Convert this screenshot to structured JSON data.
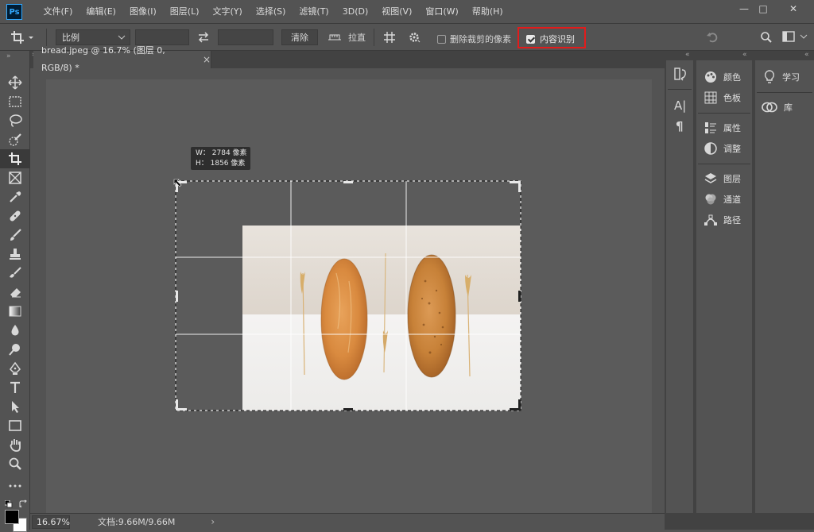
{
  "app": {
    "logo": "Ps"
  },
  "menu": [
    "文件(F)",
    "编辑(E)",
    "图像(I)",
    "图层(L)",
    "文字(Y)",
    "选择(S)",
    "滤镜(T)",
    "3D(D)",
    "视图(V)",
    "窗口(W)",
    "帮助(H)"
  ],
  "window_controls": {
    "minimize": "—",
    "maximize": "□",
    "close": "✕"
  },
  "options": {
    "ratio_select": "比例",
    "clear_label": "清除",
    "straighten_label": "拉直",
    "delete_cropped_label": "删除裁剪的像素",
    "delete_cropped_checked": false,
    "content_aware_label": "内容识别",
    "content_aware_checked": true,
    "highlight_color": "#e21b1b"
  },
  "document": {
    "tab_title": "bread.jpeg @ 16.7% (图层 0, RGB/8) *",
    "tab_close": "×"
  },
  "crop_info": {
    "w_line": "W： 2784 像素",
    "h_line": "H： 1856 像素"
  },
  "status": {
    "zoom": "16.67%",
    "doc_info": "文档:9.66M/9.66M",
    "arrow": "›"
  },
  "panels": {
    "column1": [
      "颜色",
      "色板",
      "属性",
      "调整",
      "图层",
      "通道",
      "路径"
    ],
    "column2": [
      "学习",
      "库"
    ]
  },
  "colors": {
    "ui_bg": "#535353",
    "canvas": "#5b5b5b",
    "dark_border": "#3a3a3a",
    "accent_blue": "#31a8ff"
  }
}
